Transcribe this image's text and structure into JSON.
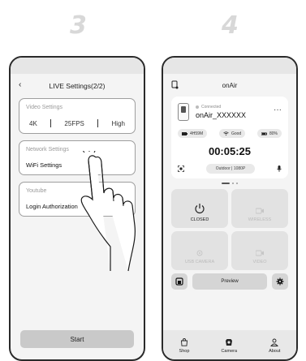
{
  "steps": {
    "left": "3",
    "right": "4"
  },
  "left_phone": {
    "header_title": "LIVE Settings(2/2)",
    "video_settings": {
      "title": "Video Settings",
      "resolution": "4K",
      "fps": "25FPS",
      "quality": "High"
    },
    "network_settings": {
      "title": "Network Settings",
      "value": "WiFi Settings"
    },
    "youtube": {
      "title": "Youtube",
      "value": "Login Authorization"
    },
    "start_label": "Start"
  },
  "right_phone": {
    "header_title": "onAir",
    "device": {
      "status": "Connected",
      "name": "onAir_XXXXXX",
      "more": "···",
      "battery_time": "4H59M",
      "wifi": "Good",
      "battery_pct": "80%",
      "timer": "00:05:25",
      "resolution_pill": "Outdoor | 1080P"
    },
    "tiles": [
      {
        "label": "CLOSED"
      },
      {
        "label": "WIRELESS"
      },
      {
        "label": "USB CAMERA"
      },
      {
        "label": "VIDEO"
      }
    ],
    "preview_label": "Preview",
    "tabs": [
      {
        "label": "Shop"
      },
      {
        "label": "Camera"
      },
      {
        "label": "About"
      }
    ]
  }
}
